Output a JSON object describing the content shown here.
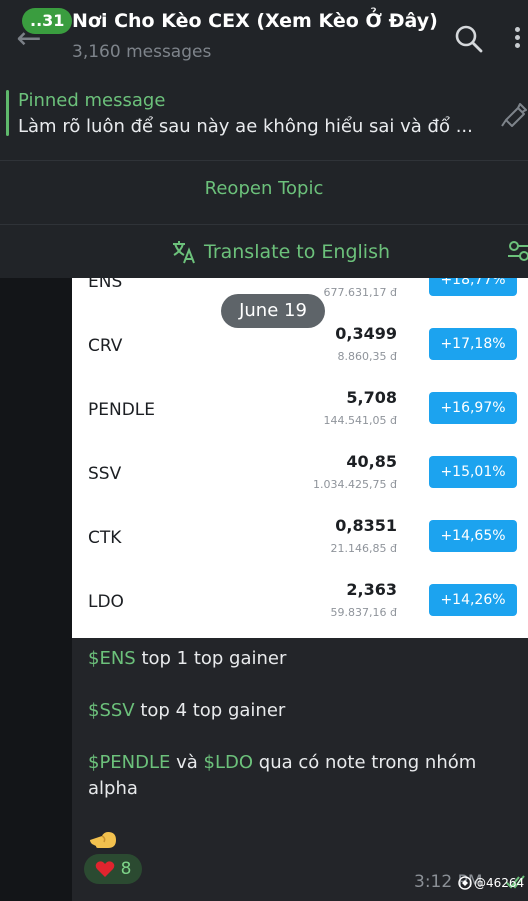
{
  "header": {
    "unread_badge": "..31",
    "title": "Nơi Cho Kèo CEX (Xem Kèo Ở Đây)",
    "subtitle": "3,160 messages"
  },
  "pinned": {
    "title": "Pinned message",
    "text": "Làm rõ luôn để sau này ae không hiểu sai và đổ ..."
  },
  "reopen_label": "Reopen Topic",
  "translate_label": "Translate to English",
  "date_pill": "June 19",
  "gainers": [
    {
      "symbol": "ENS",
      "price": "",
      "vnd": "677.631,17 đ",
      "change": "+18,77%"
    },
    {
      "symbol": "CRV",
      "price": "0,3499",
      "vnd": "8.860,35 đ",
      "change": "+17,18%"
    },
    {
      "symbol": "PENDLE",
      "price": "5,708",
      "vnd": "144.541,05 đ",
      "change": "+16,97%"
    },
    {
      "symbol": "SSV",
      "price": "40,85",
      "vnd": "1.034.425,75 đ",
      "change": "+15,01%"
    },
    {
      "symbol": "CTK",
      "price": "0,8351",
      "vnd": "21.146,85 đ",
      "change": "+14,65%"
    },
    {
      "symbol": "LDO",
      "price": "2,363",
      "vnd": "59.837,16 đ",
      "change": "+14,26%"
    }
  ],
  "message": {
    "line1_tag": "$ENS",
    "line1_text": " top 1 top gainer",
    "line2_tag": "$SSV",
    "line2_text": " top 4 top gainer",
    "line3_tag1": "$PENDLE",
    "line3_mid": " và ",
    "line3_tag2": "$LDO",
    "line3_text": " qua có note trong nhóm",
    "line4": "alpha"
  },
  "reaction": {
    "icon": "heart-icon",
    "count": "8"
  },
  "time": "3:12 PM",
  "watermark": "@46264",
  "colors": {
    "accent_green": "#6cc17b",
    "gainer_blue": "#1ca3ef",
    "header_bg": "#212428"
  }
}
